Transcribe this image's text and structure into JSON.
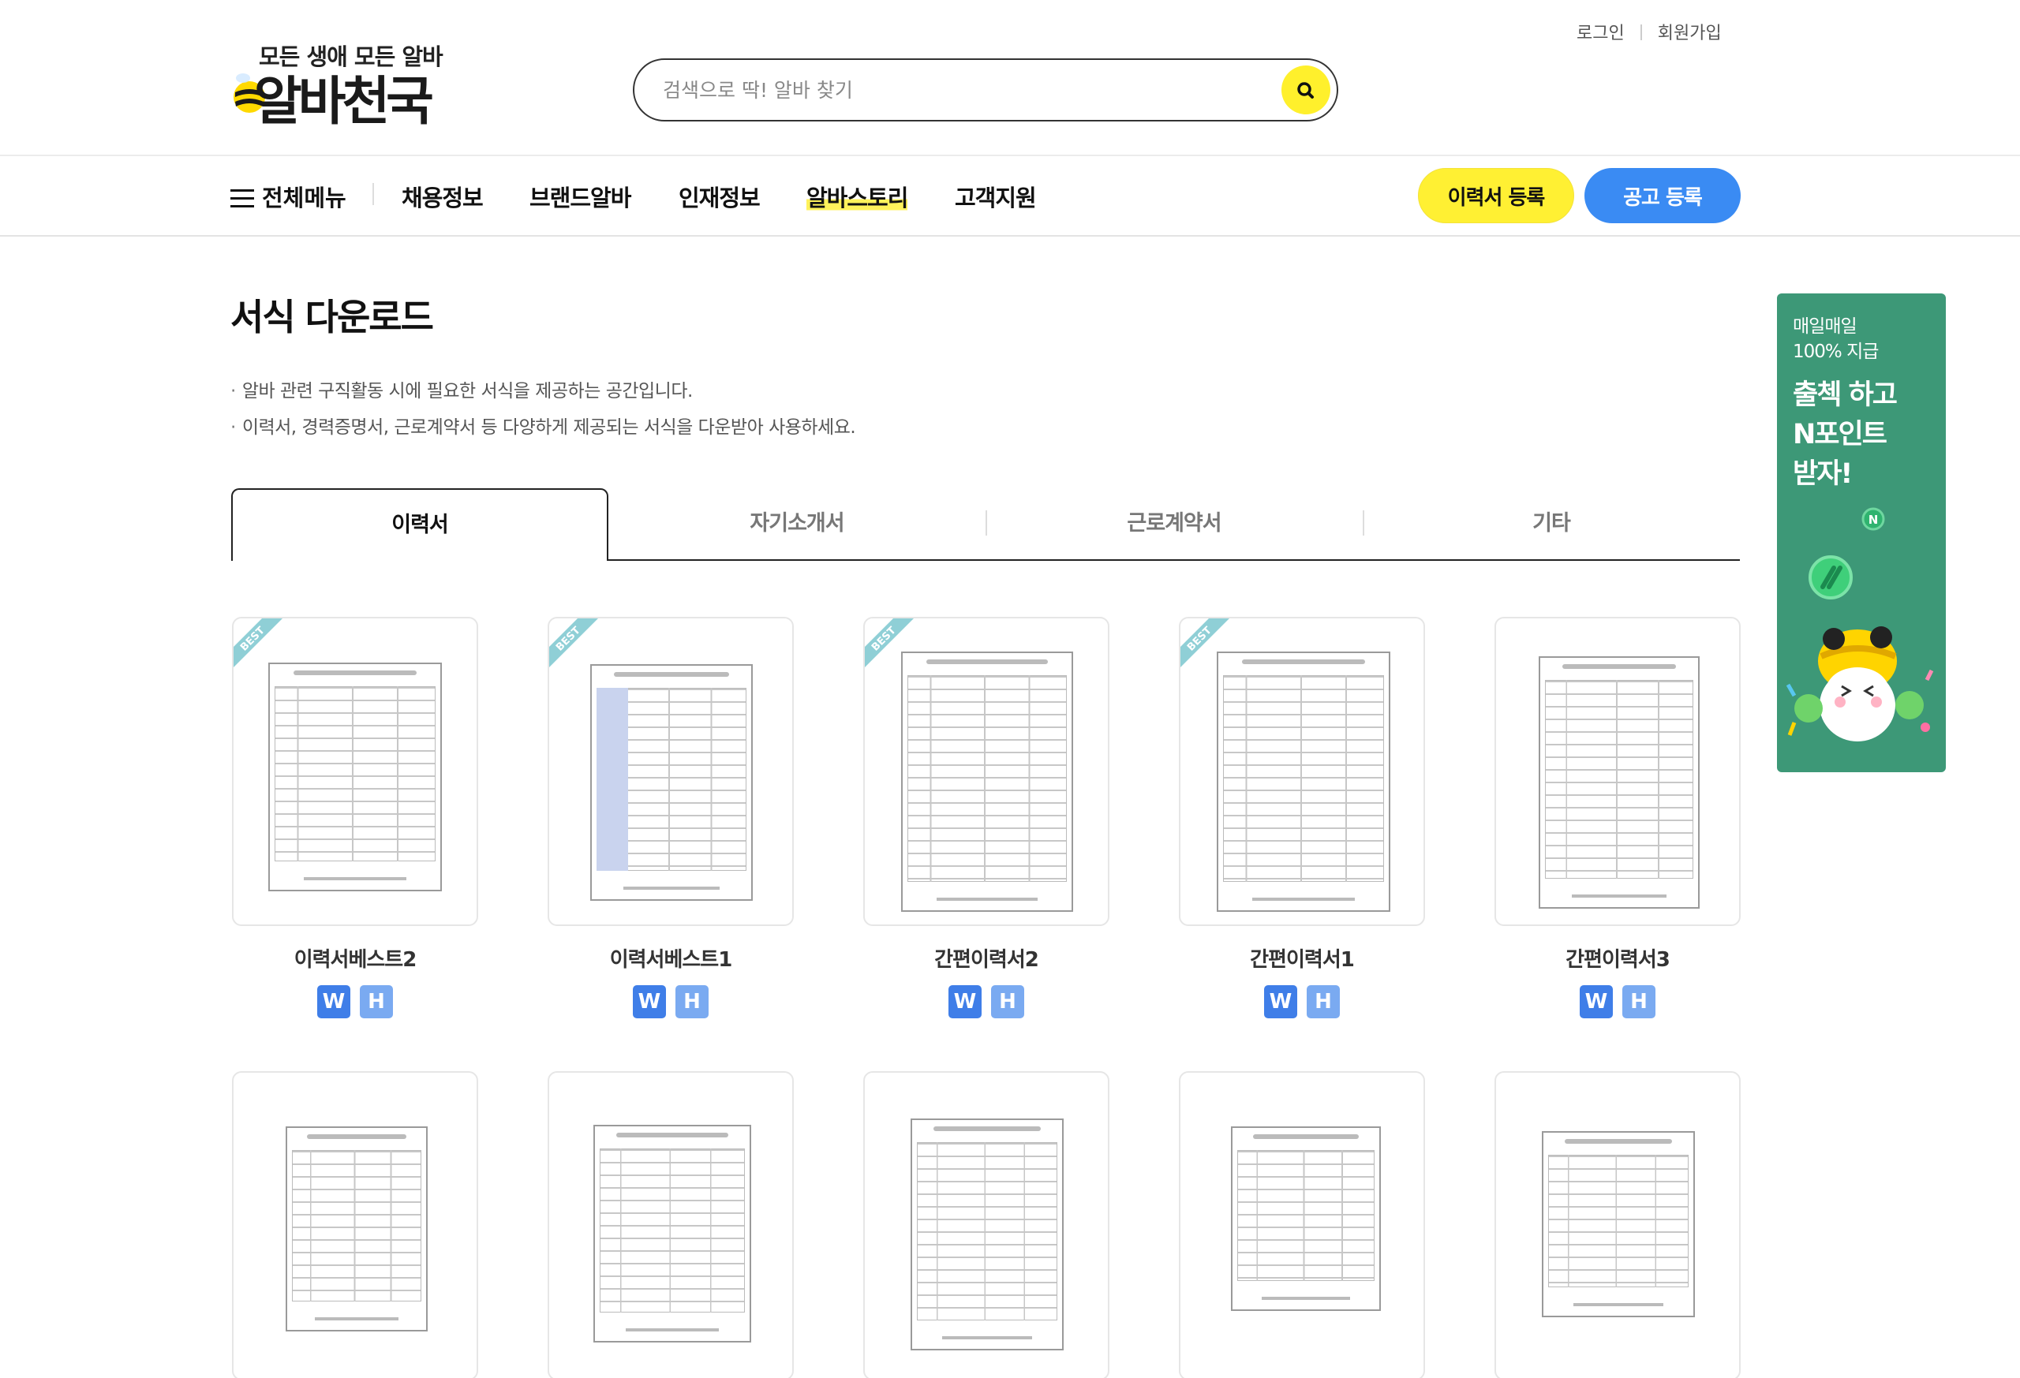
{
  "header": {
    "logo": {
      "slogan": "모든 생애 모든 알바",
      "name": "알바천국"
    },
    "search": {
      "placeholder": "검색으로 딱! 알바 찾기"
    },
    "util": {
      "login": "로그인",
      "signup": "회원가입"
    },
    "gnb": {
      "all_menu": "전체메뉴",
      "items": [
        "채용정보",
        "브랜드알바",
        "인재정보",
        "알바스토리",
        "고객지원"
      ],
      "active_index": 3
    },
    "buttons": {
      "resume": "이력서 등록",
      "post": "공고 등록"
    }
  },
  "main": {
    "title": "서식 다운로드",
    "desc": [
      "알바 관련 구직활동 시에 필요한 서식을 제공하는 공간입니다.",
      "이력서, 경력증명서, 근로계약서 등 다양하게 제공되는 서식을 다운받아 사용하세요."
    ],
    "tabs": [
      "이력서",
      "자기소개서",
      "근로계약서",
      "기타"
    ],
    "active_tab": 0,
    "format_labels": {
      "word": "W",
      "hwp": "H"
    },
    "best_label": "BEST",
    "cards": [
      {
        "title": "이력서베스트2",
        "best": true
      },
      {
        "title": "이력서베스트1",
        "best": true
      },
      {
        "title": "간편이력서2",
        "best": true
      },
      {
        "title": "간편이력서1",
        "best": true
      },
      {
        "title": "간편이력서3",
        "best": false
      },
      {
        "title": "",
        "best": false
      },
      {
        "title": "",
        "best": false
      },
      {
        "title": "",
        "best": false
      },
      {
        "title": "",
        "best": false
      },
      {
        "title": "",
        "best": false
      }
    ]
  },
  "banner": {
    "sub": "매일매일\n100% 지급",
    "main": "출첵 하고\nN포인트\n받자!",
    "coin_letter": "N",
    "color": "#3d9877"
  },
  "colors": {
    "accent_yellow": "#fff033",
    "accent_blue": "#3a8bf3",
    "word_icon": "#3f7ee8",
    "hwp_icon": "#7aaaf1",
    "best_ribbon": "#8fcfd6"
  }
}
